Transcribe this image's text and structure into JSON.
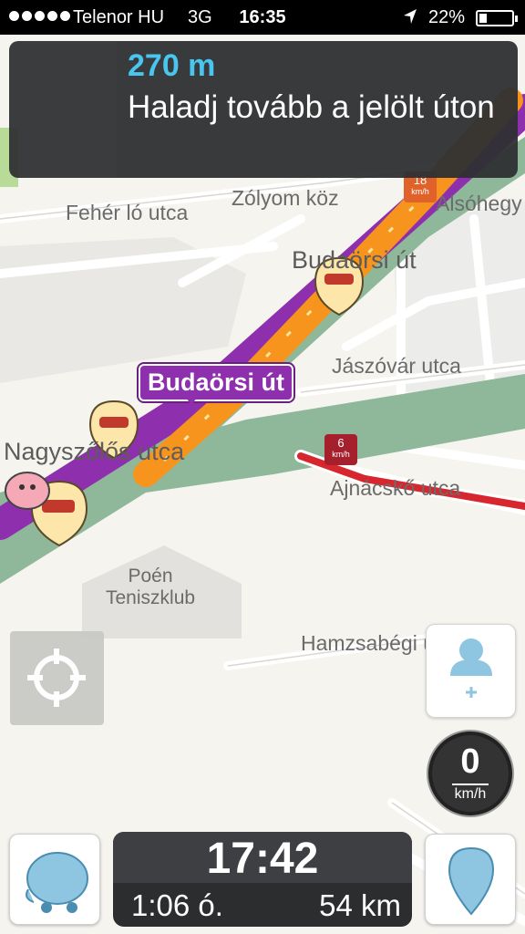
{
  "status_bar": {
    "carrier": "Telenor HU",
    "network": "3G",
    "time": "16:35",
    "battery_percent": "22%",
    "signal_bars": 5,
    "location_icon": "location-arrow-icon",
    "battery_level": 0.22
  },
  "instruction": {
    "distance": "270 m",
    "text": "Haladj tovább a jelölt úton",
    "arrow_icon": "straight-arrow-icon"
  },
  "map": {
    "labels": {
      "feher_lo": "Fehér ló utca",
      "zolyom": "Zólyom köz",
      "alsohegy": "Alsóhegy",
      "budaorsi_upper": "Budaörsi út",
      "jaszovar": "Jászóvár utca",
      "nagyszolos": "Nagyszőlős utca",
      "ajnacsko": "Ajnácskő utca",
      "poen_line1": "Poén",
      "poen_line2": "Teniszklub",
      "hamzsabegi": "Hamzsabégi út"
    },
    "current_road": "Budaörsi út",
    "speed_signs": [
      {
        "value": "18",
        "unit": "km/h",
        "color": "#e0622a"
      },
      {
        "value": "6",
        "unit": "km/h",
        "color": "#a5202c"
      }
    ],
    "colors": {
      "route": "#f7941d",
      "route_border": "#8e2fae",
      "highway": "#8fb89a",
      "jam": "#d7262e"
    }
  },
  "controls": {
    "recenter_icon": "crosshair-icon",
    "contacts_icon": "add-contact-icon",
    "speed_value": "0",
    "speed_unit": "km/h",
    "report_icon": "waze-bubble-icon",
    "search_icon": "map-pin-icon"
  },
  "eta": {
    "arrival_time": "17:42",
    "duration": "1:06 ó.",
    "distance": "54 km"
  }
}
